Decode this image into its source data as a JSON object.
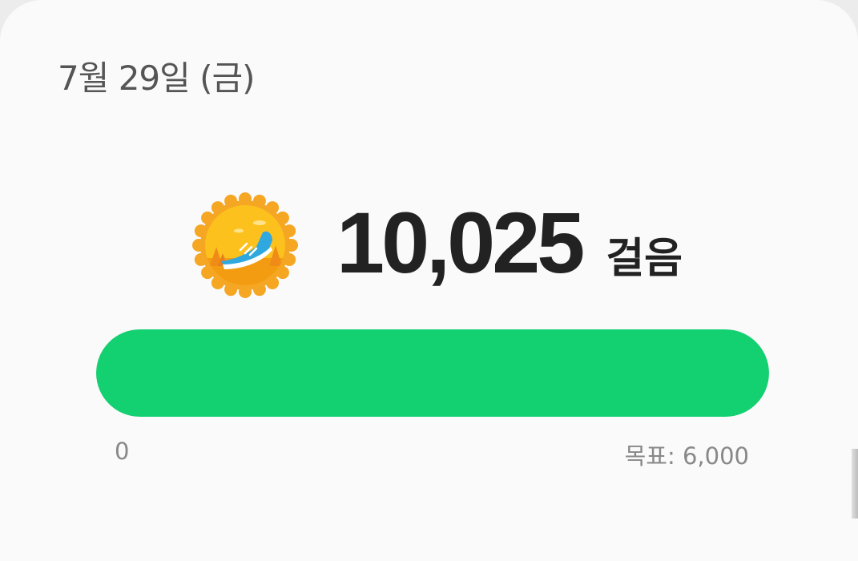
{
  "header": {
    "date": "7월 29일 (금)"
  },
  "summary": {
    "badge_icon": "walking-shoe-medal-icon",
    "steps": "10,025",
    "unit": "걸음"
  },
  "progress": {
    "min_label": "0",
    "goal_label": "목표: 6,000",
    "value": 10025,
    "goal": 6000,
    "fraction": 1.0,
    "fill_color": "#13d071"
  }
}
